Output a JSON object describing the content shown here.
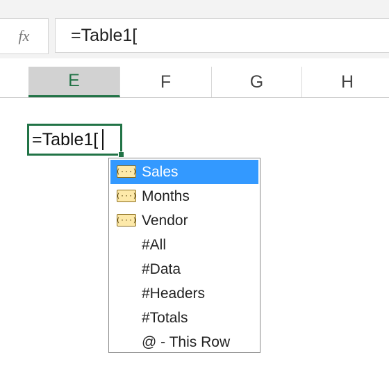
{
  "formula_bar": {
    "fx_label": "fx",
    "formula": "=Table1["
  },
  "columns": [
    "E",
    "F",
    "G",
    "H"
  ],
  "selected_column": "E",
  "active_cell": {
    "value": "=Table1["
  },
  "autocomplete": {
    "items": [
      {
        "label": "Sales",
        "icon": "table-column-icon",
        "selected": true
      },
      {
        "label": "Months",
        "icon": "table-column-icon",
        "selected": false
      },
      {
        "label": "Vendor",
        "icon": "table-column-icon",
        "selected": false
      },
      {
        "label": "#All",
        "icon": "",
        "selected": false
      },
      {
        "label": "#Data",
        "icon": "",
        "selected": false
      },
      {
        "label": "#Headers",
        "icon": "",
        "selected": false
      },
      {
        "label": "#Totals",
        "icon": "",
        "selected": false
      },
      {
        "label": "@ - This Row",
        "icon": "",
        "selected": false
      }
    ],
    "icon_glyph": "(···)"
  },
  "colors": {
    "accent_green": "#217346",
    "selection_blue": "#3399ff",
    "icon_fill": "#fde9a9"
  }
}
